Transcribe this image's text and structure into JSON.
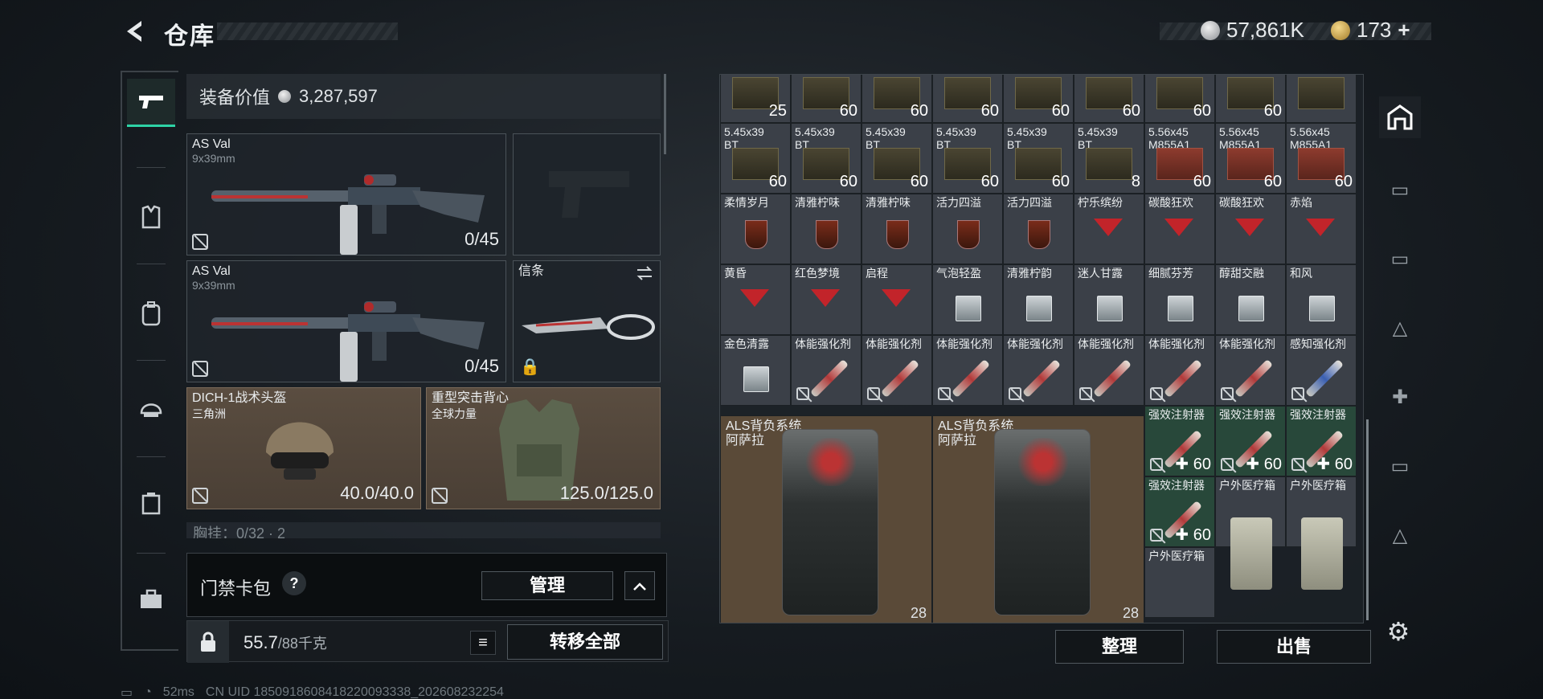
{
  "topbar": {
    "back_icon": "back-arrow-icon",
    "title": "仓库",
    "silver_amount": "57,861K",
    "gold_amount": "173",
    "gold_plus": "+"
  },
  "equipment": {
    "value_label": "装备价值",
    "value_amount": "3,287,597",
    "primary1": {
      "name": "AS Val",
      "caliber": "9x39mm",
      "ammo": "0/45"
    },
    "pistol": {
      "name": ""
    },
    "primary2": {
      "name": "AS Val",
      "caliber": "9x39mm",
      "ammo": "0/45"
    },
    "melee": {
      "name": "信条"
    },
    "helmet": {
      "name": "DICH-1战术头盔",
      "origin": "三角洲",
      "durability": "40.0/40.0"
    },
    "armor": {
      "name": "重型突击背心",
      "origin": "全球力量",
      "durability": "125.0/125.0"
    },
    "chest_rig_partial": "胸挂：0/32 · 2",
    "card": {
      "label": "门禁卡包",
      "help": "?",
      "manage": "管理",
      "collapse": "︿"
    },
    "weight": "55.7",
    "weight_max": "/88千克",
    "transfer_all": "转移全部"
  },
  "grid": {
    "row0": [
      {
        "qty": "25"
      },
      {
        "qty": "60"
      },
      {
        "qty": "60"
      },
      {
        "qty": "60"
      },
      {
        "qty": "60"
      },
      {
        "qty": "60"
      },
      {
        "qty": "60"
      },
      {
        "qty": "60"
      },
      {
        "qty": ""
      }
    ],
    "row1": [
      {
        "n1": "5.45x39",
        "n2": "BT",
        "qty": "60"
      },
      {
        "n1": "5.45x39",
        "n2": "BT",
        "qty": "60"
      },
      {
        "n1": "5.45x39",
        "n2": "BT",
        "qty": "60"
      },
      {
        "n1": "5.45x39",
        "n2": "BT",
        "qty": "60"
      },
      {
        "n1": "5.45x39",
        "n2": "BT",
        "qty": "60"
      },
      {
        "n1": "5.45x39",
        "n2": "BT",
        "qty": "8"
      },
      {
        "n1": "5.56x45",
        "n2": "M855A1",
        "qty": "60"
      },
      {
        "n1": "5.56x45",
        "n2": "M855A1",
        "qty": "60"
      },
      {
        "n1": "5.56x45",
        "n2": "M855A1",
        "qty": "60"
      }
    ],
    "row2": [
      "柔情岁月",
      "清雅柠味",
      "清雅柠味",
      "活力四溢",
      "活力四溢",
      "柠乐缤纷",
      "碳酸狂欢",
      "碳酸狂欢",
      "赤焰"
    ],
    "row3": [
      "黄昏",
      "红色梦境",
      "启程",
      "气泡轻盈",
      "清雅柠韵",
      "迷人甘露",
      "细腻芬芳",
      "醇甜交融",
      "和风"
    ],
    "row4": [
      "金色清露",
      "体能强化剂",
      "体能强化剂",
      "体能强化剂",
      "体能强化剂",
      "体能强化剂",
      "体能强化剂",
      "体能强化剂",
      "感知强化剂"
    ],
    "backpack1": {
      "name": "ALS背负系统",
      "origin": "阿萨拉",
      "weight": "28"
    },
    "backpack2": {
      "name": "ALS背负系统",
      "origin": "阿萨拉",
      "weight": "28"
    },
    "injector": {
      "name": "强效注射器",
      "qty": "60",
      "plus": "✚"
    },
    "medkit": {
      "name": "户外医疗箱"
    },
    "sort": "整理",
    "sell": "出售"
  },
  "status": {
    "ping": "52ms",
    "uid": "CN UID 1850918608418220093338_202608232254"
  }
}
